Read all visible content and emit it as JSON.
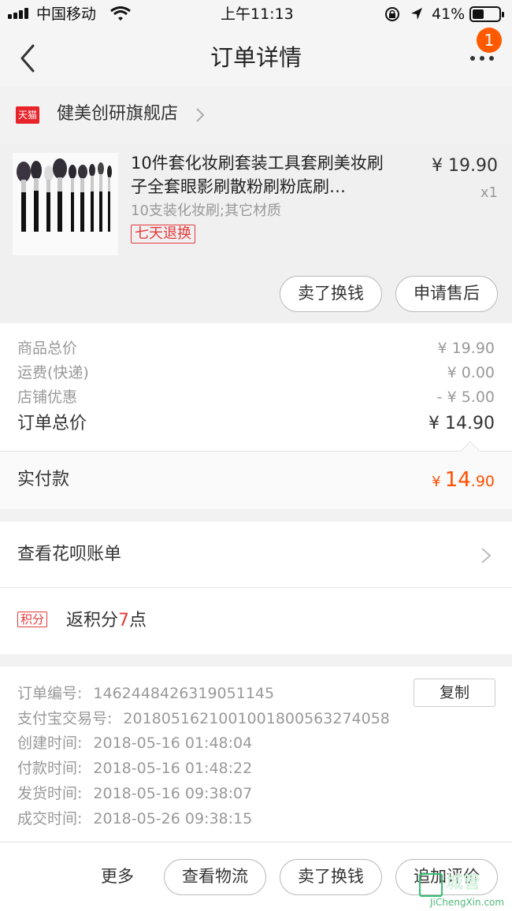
{
  "status_bar": {
    "carrier": "中国移动",
    "time": "上午11:13",
    "battery": "41%"
  },
  "nav": {
    "title": "订单详情",
    "badge_count": "1"
  },
  "shop": {
    "logo_text": "天猫",
    "name": "健美创研旗舰店"
  },
  "product": {
    "title": "10件套化妆刷套装工具套刷美妆刷子全套眼影刷散粉刷粉底刷…",
    "price": "¥ 19.90",
    "quantity": "x1",
    "sku": "10支装化妆刷;其它材质",
    "tag": "七天退换",
    "buttons": [
      "卖了换钱",
      "申请售后"
    ]
  },
  "price_summary": {
    "rows": [
      {
        "label": "商品总价",
        "value": "¥ 19.90"
      },
      {
        "label": "运费(快递)",
        "value": "¥ 0.00"
      },
      {
        "label": "店铺优惠",
        "value": "- ¥ 5.00"
      }
    ],
    "total_label": "订单总价",
    "total_value": "¥ 14.90"
  },
  "paid": {
    "label": "实付款",
    "currency": "¥",
    "integer": "14",
    "decimal": ".90"
  },
  "huabei": {
    "label": "查看花呗账单"
  },
  "points": {
    "tag": "积分",
    "prefix": "返积分",
    "number": "7",
    "suffix": "点"
  },
  "order_info": {
    "copy_label": "复制",
    "rows": [
      {
        "label": "订单编号:",
        "value": "1462448426319051145"
      },
      {
        "label": "支付宝交易号:",
        "value": "2018051621001001800563274058"
      },
      {
        "label": "创建时间:",
        "value": "2018-05-16 01:48:04"
      },
      {
        "label": "付款时间:",
        "value": "2018-05-16 01:48:22"
      },
      {
        "label": "发货时间:",
        "value": "2018-05-16 09:38:07"
      },
      {
        "label": "成交时间:",
        "value": "2018-05-26 09:38:15"
      }
    ]
  },
  "bottom_bar": {
    "more": "更多",
    "buttons": [
      "查看物流",
      "卖了换钱",
      "追加评价"
    ]
  },
  "watermark": {
    "text": "城管",
    "sub": "JiChengXin.com"
  },
  "colors": {
    "accent_orange": "#ff5000",
    "tmall_red": "#e8232a",
    "tag_red": "#e4393c"
  }
}
